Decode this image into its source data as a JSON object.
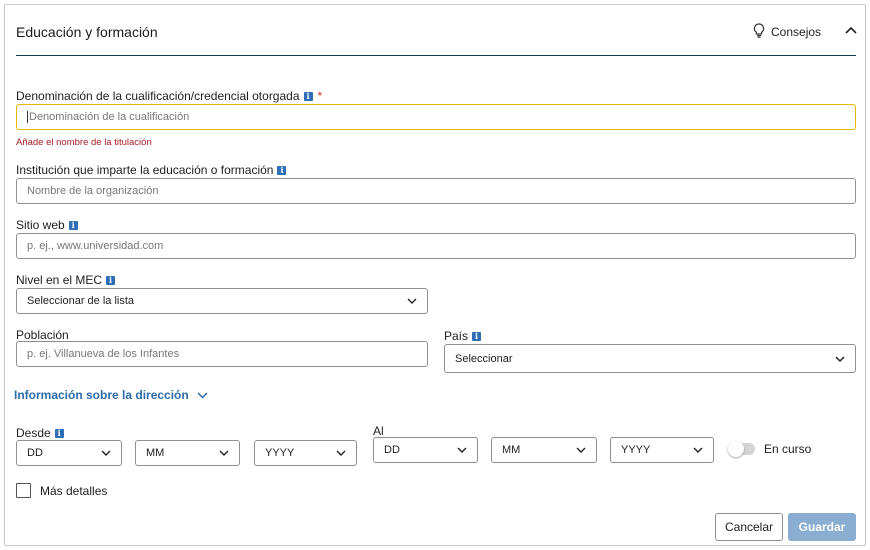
{
  "header": {
    "title": "Educación y formación",
    "tips_label": "Consejos"
  },
  "fields": {
    "qualification": {
      "label": "Denominación de la cualificación/credencial otorgada",
      "required_mark": "*",
      "placeholder": "Denominación de la cualificación",
      "error": "Añade el nombre de la titulación"
    },
    "institution": {
      "label": "Institución que imparte la educación o formación",
      "placeholder": "Nombre de la organización"
    },
    "website": {
      "label": "Sitio web",
      "placeholder": "p. ej., www.universidad.com"
    },
    "mec_level": {
      "label": "Nivel en el MEC",
      "value": "Seleccionar de la lista"
    },
    "city": {
      "label": "Población",
      "placeholder": "p. ej. Villanueva de los Infantes"
    },
    "country": {
      "label": "País",
      "value": "Seleccionar"
    },
    "address_link": "Información sobre la dirección",
    "from": {
      "label": "Desde",
      "day": "DD",
      "month": "MM",
      "year": "YYYY"
    },
    "to": {
      "label": "Al",
      "day": "DD",
      "month": "MM",
      "year": "YYYY"
    },
    "ongoing": {
      "label": "En curso",
      "on": false
    },
    "more_details": {
      "label": "Más detalles",
      "checked": false
    }
  },
  "buttons": {
    "cancel": "Cancelar",
    "save": "Guardar"
  },
  "info_glyph": "i",
  "colors": {
    "primary": "#2d6ca8",
    "divider": "#133c55",
    "error": "#a61d24",
    "focus_border": "#e5b800",
    "save_disabled": "#8aaed1"
  }
}
